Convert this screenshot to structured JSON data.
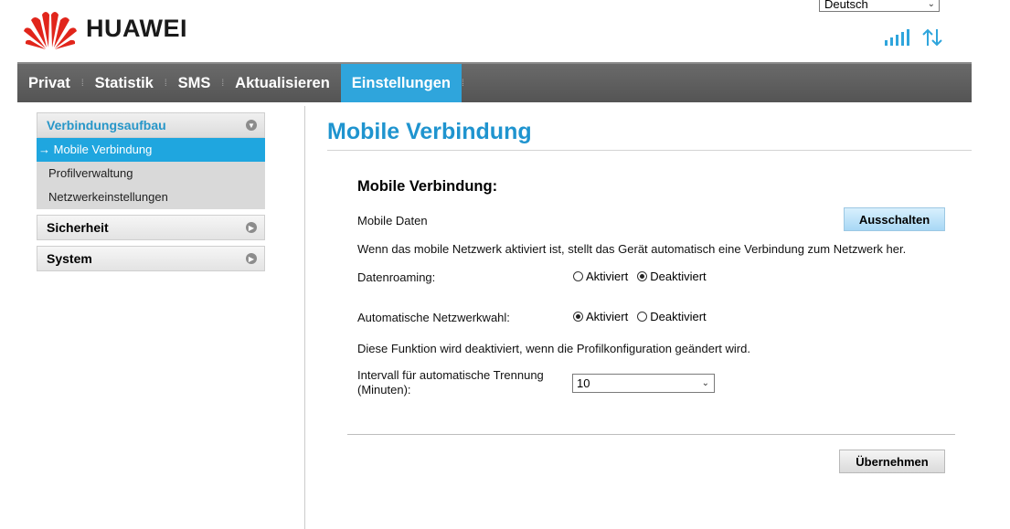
{
  "header": {
    "brand": "HUAWEI",
    "language": "Deutsch",
    "colors": {
      "logo_red": "#e1251b",
      "accent": "#2fa5dc"
    }
  },
  "nav": {
    "items": [
      {
        "label": "Privat"
      },
      {
        "label": "Statistik"
      },
      {
        "label": "SMS"
      },
      {
        "label": "Aktualisieren"
      },
      {
        "label": "Einstellungen",
        "active": true
      }
    ]
  },
  "sidebar": {
    "sections": [
      {
        "label": "Verbindungsaufbau",
        "expanded": true,
        "items": [
          {
            "label": "→ Mobile Verbindung",
            "active": true
          },
          {
            "label": "Profilverwaltung"
          },
          {
            "label": "Netzwerkeinstellungen"
          }
        ]
      },
      {
        "label": "Sicherheit",
        "expanded": false
      },
      {
        "label": "System",
        "expanded": false
      }
    ]
  },
  "main": {
    "page_title": "Mobile Verbindung",
    "section_title": "Mobile Verbindung:",
    "mobile_data_label": "Mobile Daten",
    "mobile_data_button": "Ausschalten",
    "info_text": "Wenn das mobile Netzwerk aktiviert ist, stellt das Gerät automatisch eine Verbindung zum Netzwerk her.",
    "roaming": {
      "label": "Datenroaming:",
      "option_on": "Aktiviert",
      "option_off": "Deaktiviert",
      "selected": "Deaktiviert"
    },
    "auto_network": {
      "label": "Automatische Netzwerkwahl:",
      "option_on": "Aktiviert",
      "option_off": "Deaktiviert",
      "selected": "Aktiviert"
    },
    "profile_note": "Diese Funktion wird deaktiviert, wenn die Profilkonfiguration geändert wird.",
    "interval": {
      "label_line1": "Intervall für automatische Trennung",
      "label_line2": "(Minuten):",
      "value": "10"
    },
    "apply_button": "Übernehmen"
  }
}
